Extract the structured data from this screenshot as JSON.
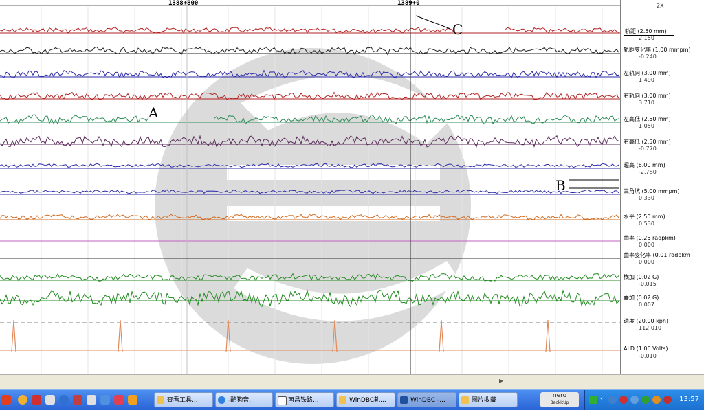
{
  "ruler": {
    "km_left": "1388+800",
    "km_right": "1389+0",
    "zoom": "2X"
  },
  "annotations": {
    "a": "A",
    "b": "B",
    "c": "C"
  },
  "channels": [
    {
      "label": "轨距 (2.50 mm)",
      "value": "2.150",
      "color": "#b22222"
    },
    {
      "label": "轨距变化率 (1.00 mmpm)",
      "value": "-0.240",
      "color": "#202020"
    },
    {
      "label": "左轨向 (3.00 mm)",
      "value": "1.490",
      "color": "#2b2ba8"
    },
    {
      "label": "右轨向 (3.00 mm)",
      "value": "3.710",
      "color": "#b22222"
    },
    {
      "label": "左高低 (2.50 mm)",
      "value": "1.050",
      "color": "#2e8b57"
    },
    {
      "label": "右高低 (2.50 mm)",
      "value": "-0.770",
      "color": "#5a2a5a"
    },
    {
      "label": "超高 (6.00 mm)",
      "value": "-2.780",
      "color": "#2b2ba8"
    },
    {
      "label": "三角坑 (5.00 mmpm)",
      "value": "0.330",
      "color": "#2b2ba8"
    },
    {
      "label": "水平 (2.50 mm)",
      "value": "0.530",
      "color": "#d2691e"
    },
    {
      "label": "曲率 (0.25 radpkm)",
      "value": "0.000",
      "color": "#c060c0"
    },
    {
      "label": "曲率变化率 (0.01 radpkm",
      "value": "0.000",
      "color": "#202020"
    },
    {
      "label": "横加 (0.02 G)",
      "value": "-0.015",
      "color": "#228b22"
    },
    {
      "label": "垂加 (0.02 G)",
      "value": "0.007",
      "color": "#228b22"
    },
    {
      "label": "速度 (20.00 kph)",
      "value": "112.010",
      "color": "#808080"
    },
    {
      "label": "ALD (1.00 Volts)",
      "value": "-0.010",
      "color": "#e08a5a"
    }
  ],
  "taskbar": {
    "items": [
      {
        "label": "查看工具..."
      },
      {
        "label": "-酷狗音..."
      },
      {
        "label": "南昌铁路..."
      },
      {
        "label": "WinDBC轨..."
      },
      {
        "label": "WinDBC -..."
      },
      {
        "label": "图片收藏"
      }
    ],
    "nero": "nero",
    "nero_sub": "BackItUp",
    "clock": "13:57"
  }
}
